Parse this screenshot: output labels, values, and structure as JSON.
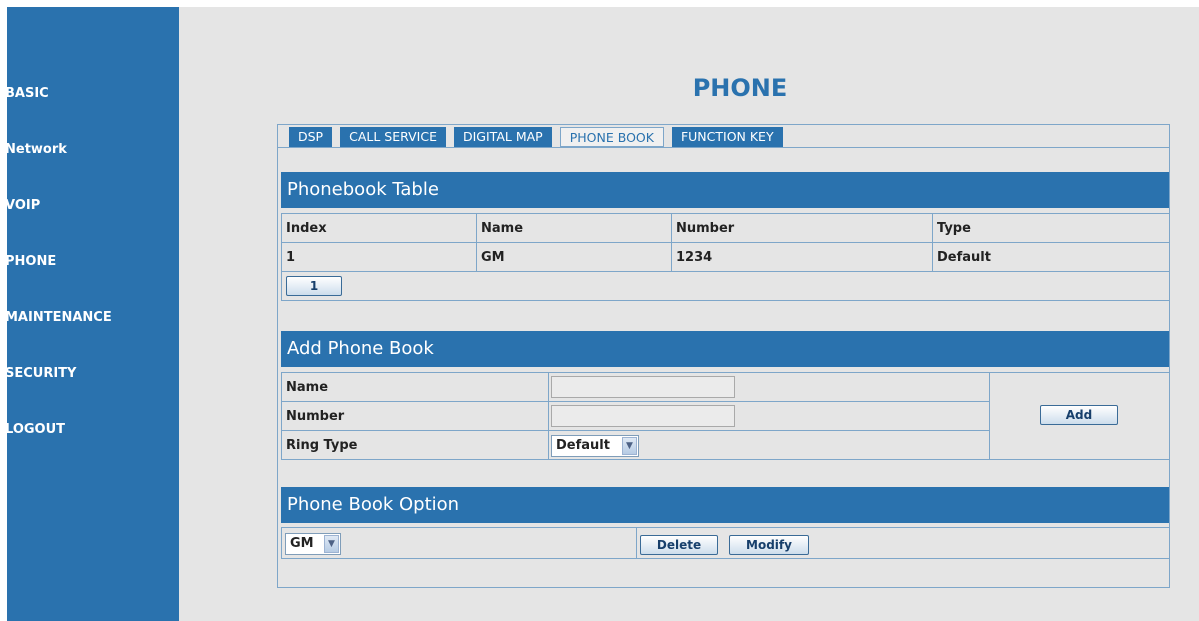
{
  "sidebar": {
    "items": [
      {
        "label": "BASIC"
      },
      {
        "label": "Network"
      },
      {
        "label": "VOIP"
      },
      {
        "label": "PHONE"
      },
      {
        "label": "MAINTENANCE"
      },
      {
        "label": "SECURITY"
      },
      {
        "label": "LOGOUT"
      }
    ]
  },
  "page_title": "PHONE",
  "tabs": [
    {
      "label": "DSP"
    },
    {
      "label": "CALL SERVICE"
    },
    {
      "label": "DIGITAL MAP"
    },
    {
      "label": "PHONE BOOK",
      "active": true
    },
    {
      "label": "FUNCTION KEY"
    }
  ],
  "phonebook_table": {
    "title": "Phonebook Table",
    "columns": [
      "Index",
      "Name",
      "Number",
      "Type"
    ],
    "rows": [
      [
        "1",
        "GM",
        "1234",
        "Default"
      ]
    ],
    "page_button": "1"
  },
  "add_phone_book": {
    "title": "Add Phone Book",
    "name_label": "Name",
    "name_value": "",
    "number_label": "Number",
    "number_value": "",
    "ring_type_label": "Ring Type",
    "ring_type_value": "Default",
    "add_button": "Add"
  },
  "phone_book_option": {
    "title": "Phone Book Option",
    "selected_entry": "GM",
    "delete_button": "Delete",
    "modify_button": "Modify"
  },
  "colors": {
    "primary_blue": "#2a72ae",
    "background": "#e5e5e5",
    "border": "#7ea6c9"
  }
}
